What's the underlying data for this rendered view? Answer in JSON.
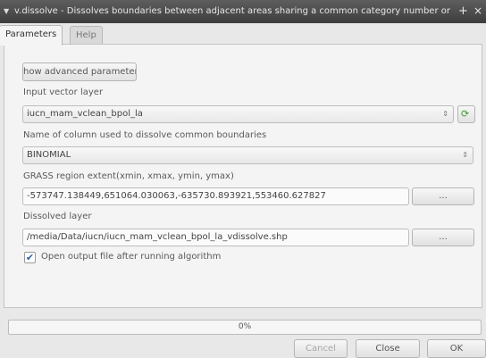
{
  "window": {
    "title": "v.dissolve - Dissolves boundaries between adjacent areas sharing a common category number or att",
    "menu_icon": "chevron-down-icon",
    "pin_icon": "pin-icon",
    "close_icon": "close-icon"
  },
  "tabs": [
    {
      "label": "Parameters",
      "active": true
    },
    {
      "label": "Help",
      "active": false
    }
  ],
  "form": {
    "advanced_button": "how advanced parameter",
    "input_layer_label": "Input vector layer",
    "input_layer_value": "iucn_mam_vclean_bpol_la",
    "column_label": "Name of column used to dissolve common boundaries",
    "column_value": "BINOMIAL",
    "region_label": "GRASS region extent(xmin, xmax, ymin, ymax)",
    "region_value": "-573747.138449,651064.030063,-635730.893921,553460.627827",
    "browse_label": "...",
    "output_label": "Dissolved layer",
    "output_value": "/media/Data/iucn/iucn_mam_vclean_bpol_la_vdissolve.shp",
    "open_output_label": "Open output file after running algorithm",
    "open_output_checked": true
  },
  "progress": {
    "text": "0%",
    "value": 0
  },
  "footer": {
    "cancel": "Cancel",
    "close": "Close",
    "ok": "OK"
  }
}
